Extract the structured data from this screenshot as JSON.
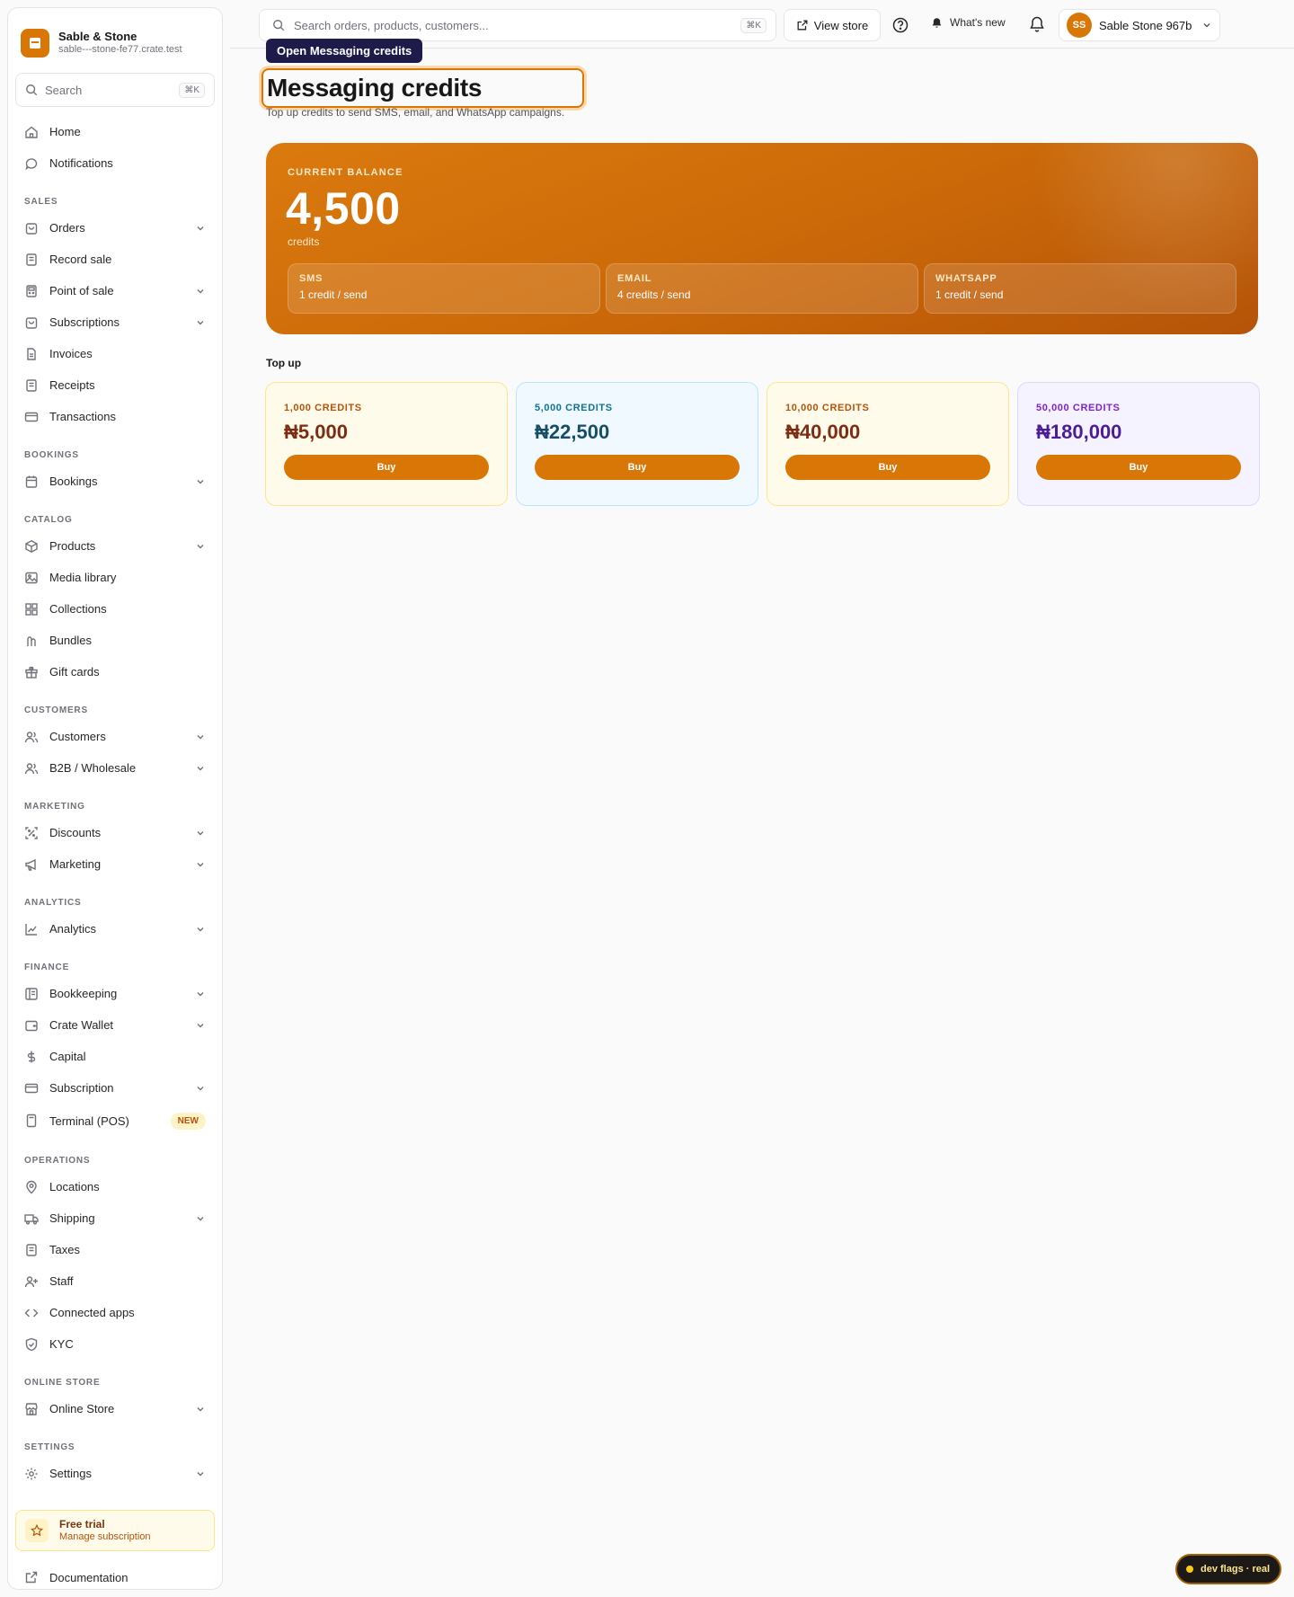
{
  "brand": {
    "name": "Sable & Stone",
    "domain": "sable---stone-fe77.crate.test"
  },
  "sidebar": {
    "search": {
      "label": "Search",
      "shortcut": "⌘K"
    },
    "top_items": [
      {
        "label": "Home",
        "icon": "home-icon"
      },
      {
        "label": "Notifications",
        "icon": "chat-bubble-icon"
      }
    ],
    "sections": {
      "sales": "SALES",
      "bookings": "BOOKINGS",
      "catalog": "CATALOG",
      "customers": "CUSTOMERS",
      "marketing": "MARKETING",
      "analytics": "ANALYTICS",
      "finance": "FINANCE",
      "operations": "OPERATIONS",
      "online_store": "ONLINE STORE",
      "settings": "SETTINGS"
    },
    "items": {
      "orders": "Orders",
      "record_sale": "Record sale",
      "point_of_sale": "Point of sale",
      "subscriptions": "Subscriptions",
      "invoices": "Invoices",
      "receipts": "Receipts",
      "transactions": "Transactions",
      "bookings": "Bookings",
      "products": "Products",
      "media_library": "Media library",
      "collections": "Collections",
      "bundles": "Bundles",
      "gift_cards": "Gift cards",
      "customers": "Customers",
      "b2b": "B2B / Wholesale",
      "discounts": "Discounts",
      "marketing": "Marketing",
      "analytics": "Analytics",
      "bookkeeping": "Bookkeeping",
      "crate_wallet": "Crate Wallet",
      "capital": "Capital",
      "subscription": "Subscription",
      "terminal": "Terminal (POS)",
      "terminal_badge": "NEW",
      "locations": "Locations",
      "shipping": "Shipping",
      "taxes": "Taxes",
      "staff": "Staff",
      "connected_apps": "Connected apps",
      "kyc": "KYC",
      "online_store": "Online Store",
      "settings": "Settings"
    },
    "trial": {
      "title": "Free trial",
      "subtitle": "Manage subscription"
    },
    "docs": "Documentation"
  },
  "topbar": {
    "search_placeholder": "Search orders, products, customers...",
    "search_shortcut": "⌘K",
    "view_store": "View store",
    "whats_new": "What's new",
    "account_initials": "SS",
    "account_name": "Sable Stone 967b"
  },
  "main": {
    "tooltip": "Open Messaging credits",
    "title": "Messaging credits",
    "subtitle": "Top up credits to send SMS, email, and WhatsApp campaigns.",
    "balance": {
      "label": "CURRENT BALANCE",
      "value": "4,500",
      "unit": "credits",
      "rates": [
        {
          "name": "SMS",
          "price": "1 credit / send"
        },
        {
          "name": "EMAIL",
          "price": "4 credits / send"
        },
        {
          "name": "WHATSAPP",
          "price": "1 credit / send"
        }
      ]
    },
    "topup_label": "Top up",
    "packs": [
      {
        "name": "1,000 CREDITS",
        "price": "₦5,000",
        "buy": "Buy"
      },
      {
        "name": "5,000 CREDITS",
        "price": "₦22,500",
        "buy": "Buy"
      },
      {
        "name": "10,000 CREDITS",
        "price": "₦40,000",
        "buy": "Buy"
      },
      {
        "name": "50,000 CREDITS",
        "price": "₦180,000",
        "buy": "Buy"
      }
    ]
  },
  "colors": {
    "accent": "#d97706",
    "pack_themes": [
      {
        "bg": "#fffbeb",
        "border": "#fde68a",
        "name": "#b45309",
        "price": "#7c2d12"
      },
      {
        "bg": "#f0f9ff",
        "border": "#bae6fd",
        "name": "#0e7490",
        "price": "#164e63"
      },
      {
        "bg": "#fffbeb",
        "border": "#fde68a",
        "name": "#b45309",
        "price": "#7c2d12"
      },
      {
        "bg": "#f5f3ff",
        "border": "#ddd6fe",
        "name": "#7e22ce",
        "price": "#4c1d95"
      }
    ]
  },
  "dev_flags": "dev flags · real"
}
